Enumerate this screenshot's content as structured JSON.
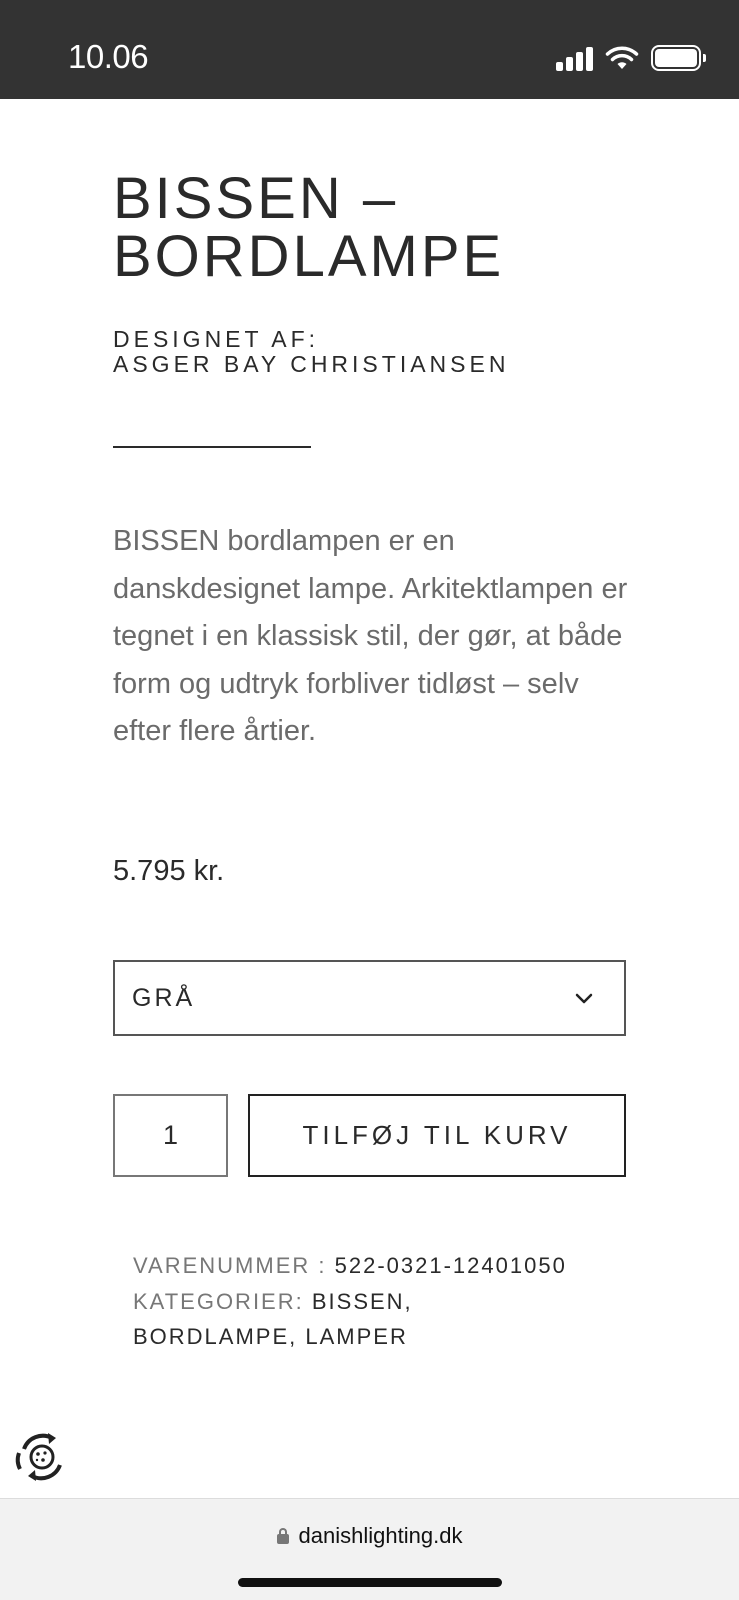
{
  "status_bar": {
    "time": "10.06",
    "icons": [
      "signal-icon",
      "wifi-icon",
      "battery-icon"
    ]
  },
  "product": {
    "title_line1": "BISSEN –",
    "title_line2": "BORDLAMPE",
    "designer_label": "DESIGNET AF:",
    "designer_name": "ASGER BAY CHRISTIANSEN",
    "description": "BISSEN bordlampen er en danskdesignet lampe. Arkitektlampen er tegnet i en klassisk stil, der gør, at både form og udtryk forbliver tidløst – selv efter flere årtier.",
    "price": "5.795 kr."
  },
  "variant": {
    "selected": "GRÅ"
  },
  "cart": {
    "quantity": "1",
    "add_label": "TILFØJ TIL KURV"
  },
  "meta": {
    "sku_label": "VARENUMMER :",
    "sku_value": "522-0321-12401050",
    "categories_label": "KATEGORIER:",
    "categories_value_line1": "BISSEN,",
    "categories_value_line2": "BORDLAMPE, LAMPER"
  },
  "browser": {
    "url": "danishlighting.dk"
  },
  "colors": {
    "status_bar_bg": "#333333",
    "text_dark": "#2a2a2a",
    "text_muted": "#6b6b6b"
  }
}
